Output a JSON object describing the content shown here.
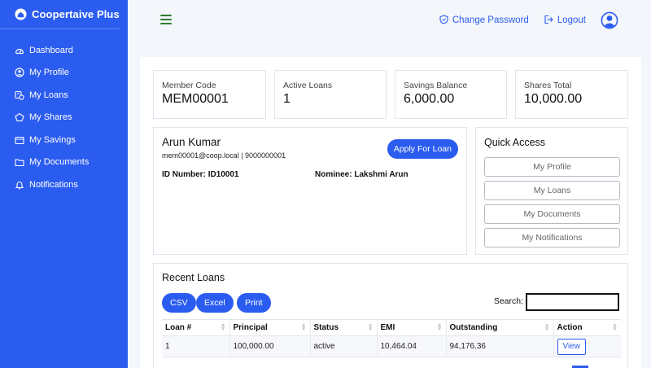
{
  "app": {
    "title": "Coopertaive Plus"
  },
  "colors": {
    "primary": "#2b5cf0",
    "hamburger": "#2e7d32"
  },
  "sidebar": {
    "items": [
      {
        "label": "Dashboard",
        "icon": "dashboard-gauge-icon"
      },
      {
        "label": "My Profile",
        "icon": "user-circle-icon"
      },
      {
        "label": "My Loans",
        "icon": "loans-icon"
      },
      {
        "label": "My Shares",
        "icon": "shares-icon"
      },
      {
        "label": "My Savings",
        "icon": "savings-wallet-icon"
      },
      {
        "label": "My Documents",
        "icon": "folder-icon"
      },
      {
        "label": "Notifications",
        "icon": "bell-icon"
      }
    ]
  },
  "topbar": {
    "change_password": "Change Password",
    "logout": "Logout"
  },
  "stats": [
    {
      "label": "Member Code",
      "value": "MEM00001"
    },
    {
      "label": "Active Loans",
      "value": "1"
    },
    {
      "label": "Savings Balance",
      "value": "6,000.00"
    },
    {
      "label": "Shares Total",
      "value": "10,000.00"
    }
  ],
  "member": {
    "name": "Arun Kumar",
    "contact": "mem00001@coop.local | 9000000001",
    "apply_label": "Apply For Loan",
    "id_label": "ID Number:",
    "id_value": "ID10001",
    "nominee_label": "Nominee:",
    "nominee_value": "Lakshmi Arun"
  },
  "quick_access": {
    "title": "Quick Access",
    "buttons": [
      "My Profile",
      "My Loans",
      "My Documents",
      "My Notifications"
    ]
  },
  "recent_loans": {
    "title": "Recent Loans",
    "export_buttons": [
      "CSV",
      "Excel",
      "Print"
    ],
    "search_label": "Search:",
    "columns": [
      "Loan #",
      "Principal",
      "Status",
      "EMI",
      "Outstanding",
      "Action"
    ],
    "rows": [
      {
        "loan_no": "1",
        "principal": "100,000.00",
        "status": "active",
        "emi": "10,464.04",
        "outstanding": "94,176.36",
        "action": "View"
      }
    ]
  }
}
